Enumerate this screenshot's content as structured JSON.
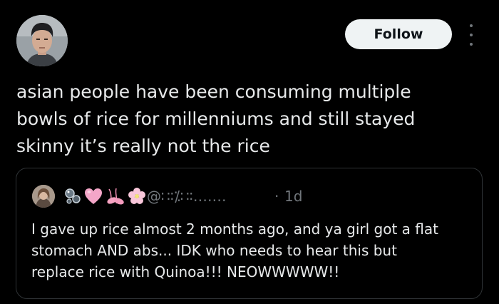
{
  "header": {
    "follow_label": "Follow",
    "avatar_icon": "profile-photo-man",
    "more_icon": "more-vertical-icon"
  },
  "tweet": {
    "text": "asian people have been consuming multiple\nbowls of rice for millenniums and still stayed\nskinny it’s really not the rice"
  },
  "quote": {
    "avatar_icon": "profile-photo-woman",
    "name_emojis": [
      "bubbles-icon",
      "pink-heart-icon",
      "ballet-shoes-icon",
      "cherry-blossom-icon"
    ],
    "handle": "@∷∶⁒∷∶‥‥․‥",
    "separator": "·",
    "time": "1d",
    "text": "I gave up rice almost 2 months ago, and ya girl got a flat\nstomach AND abs... IDK who needs to hear this but\nreplace rice with Quinoa!!! NEOWWWWW!!"
  },
  "colors": {
    "background": "#000000",
    "text_primary": "#e7e9ea",
    "text_secondary": "#71767b",
    "border": "#2f3336",
    "follow_bg": "#eff3f4",
    "follow_text": "#0f1419"
  }
}
